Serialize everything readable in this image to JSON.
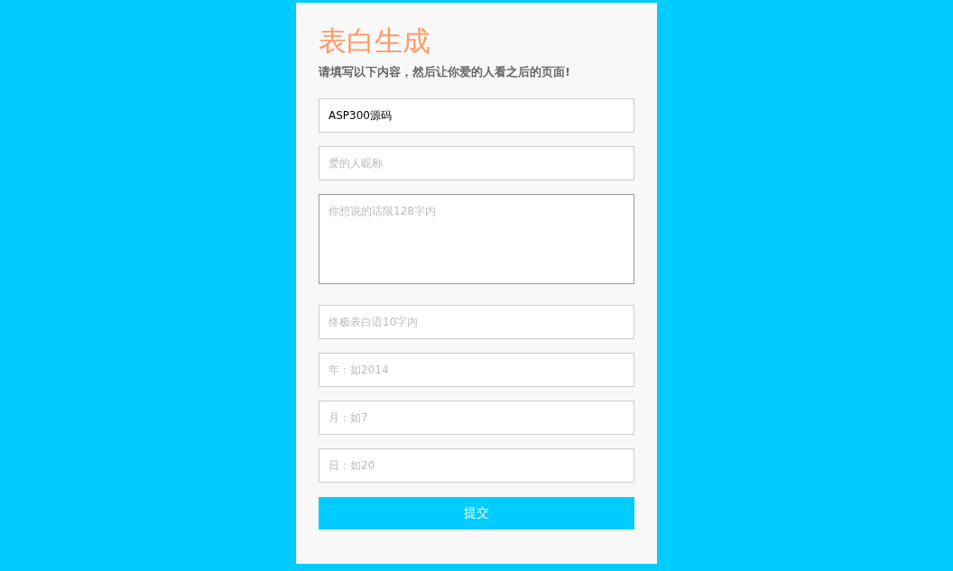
{
  "title": "表白生成",
  "subtitle": "请填写以下内容，然后让你爱的人看之后的页面!",
  "fields": [
    {
      "kind": "text",
      "value": "ASP300源码"
    },
    {
      "kind": "text",
      "placeholder": "爱的人昵称"
    },
    {
      "kind": "textarea",
      "placeholder": "你想说的话限128字内"
    },
    {
      "kind": "text",
      "placeholder": "终极表白语10字内"
    },
    {
      "kind": "text",
      "placeholder": "年：如2014"
    },
    {
      "kind": "text",
      "placeholder": "月：如7"
    },
    {
      "kind": "text",
      "placeholder": "日：如20"
    }
  ],
  "submit": "提交"
}
